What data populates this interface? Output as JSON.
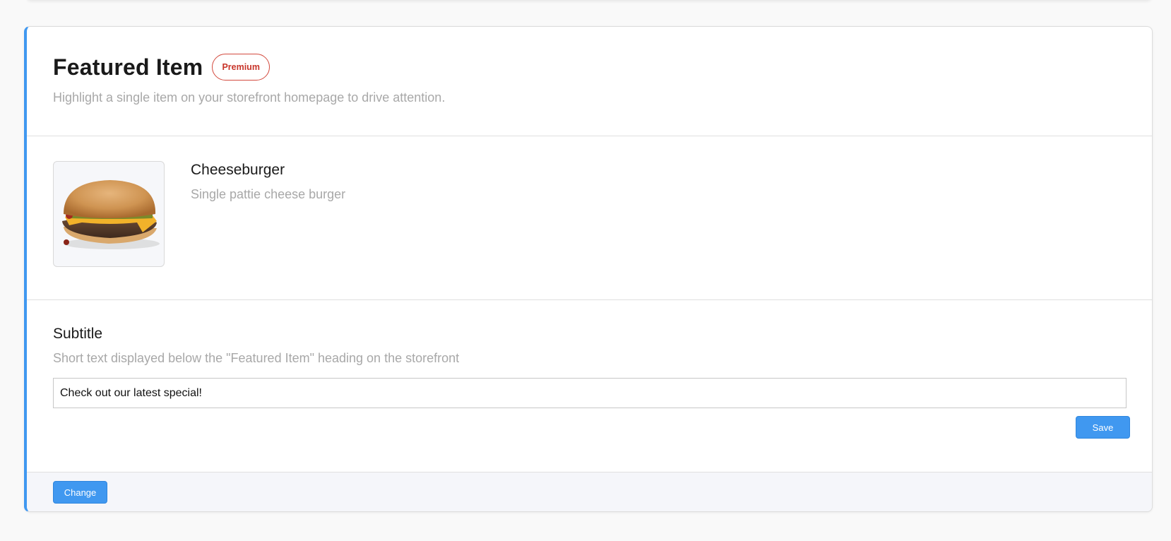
{
  "header": {
    "title": "Featured Item",
    "badge": "Premium",
    "description": "Highlight a single item on your storefront homepage to drive attention."
  },
  "item": {
    "name": "Cheeseburger",
    "description": "Single pattie cheese burger",
    "image_icon": "cheeseburger-image"
  },
  "subtitle": {
    "label": "Subtitle",
    "help": "Short text displayed below the \"Featured Item\" heading on the storefront",
    "value": "Check out our latest special!",
    "save_label": "Save"
  },
  "footer": {
    "change_label": "Change"
  },
  "colors": {
    "accent": "#4098f0",
    "badge": "#c8352a",
    "muted_text": "#a8a8a8"
  }
}
